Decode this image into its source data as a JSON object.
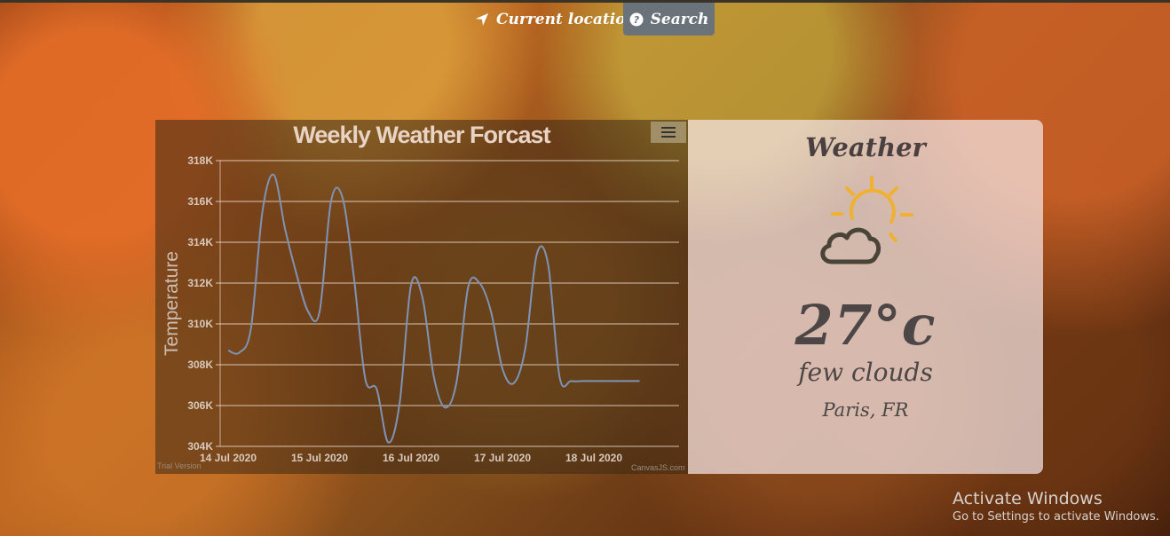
{
  "nav": {
    "current_location": "Current location",
    "search": "Search"
  },
  "chart_data": {
    "type": "line",
    "title": "Weekly Weather Forcast",
    "ylabel": "Temperature",
    "xlabel": "",
    "ylim": [
      304,
      318
    ],
    "y_ticks": [
      "304K",
      "306K",
      "308K",
      "310K",
      "312K",
      "314K",
      "316K",
      "318K"
    ],
    "x_ticks": [
      "14 Jul 2020",
      "15 Jul 2020",
      "16 Jul 2020",
      "17 Jul 2020",
      "18 Jul 2020"
    ],
    "x_range": [
      0,
      5.0
    ],
    "series": [
      {
        "name": "",
        "color": "#7f93b5",
        "x": [
          0,
          0.125,
          0.25,
          0.375,
          0.5,
          0.625,
          0.75,
          0.875,
          1.0,
          1.125,
          1.25,
          1.375,
          1.5,
          1.625,
          1.75,
          1.875,
          2.0,
          2.125,
          2.25,
          2.375,
          2.5,
          2.625,
          2.75,
          2.875,
          3.0,
          3.125,
          3.25,
          3.375,
          3.5,
          3.625,
          3.75,
          3.875,
          4.0,
          4.125,
          4.25,
          4.375,
          4.5
        ],
        "values": [
          308.7,
          308.6,
          309.8,
          315.5,
          317.3,
          314.6,
          312.4,
          310.6,
          310.6,
          316.0,
          316.2,
          312.3,
          307.3,
          306.8,
          304.2,
          306.1,
          311.9,
          311.3,
          307.4,
          305.9,
          307.2,
          311.8,
          312.0,
          310.6,
          307.8,
          307.1,
          308.8,
          313.4,
          312.9,
          307.4,
          307.2,
          307.2,
          307.2,
          307.2,
          307.2,
          307.2,
          307.2
        ]
      }
    ],
    "credit_left": "Trial Version",
    "credit_right": "CanvasJS.com"
  },
  "weather": {
    "heading": "Weather",
    "temperature": "27°c",
    "description": "few clouds",
    "city": "Paris, FR",
    "icon": "partly-cloudy-day-icon"
  },
  "watermark": {
    "line1": "Activate Windows",
    "line2": "Go to Settings to activate Windows."
  }
}
